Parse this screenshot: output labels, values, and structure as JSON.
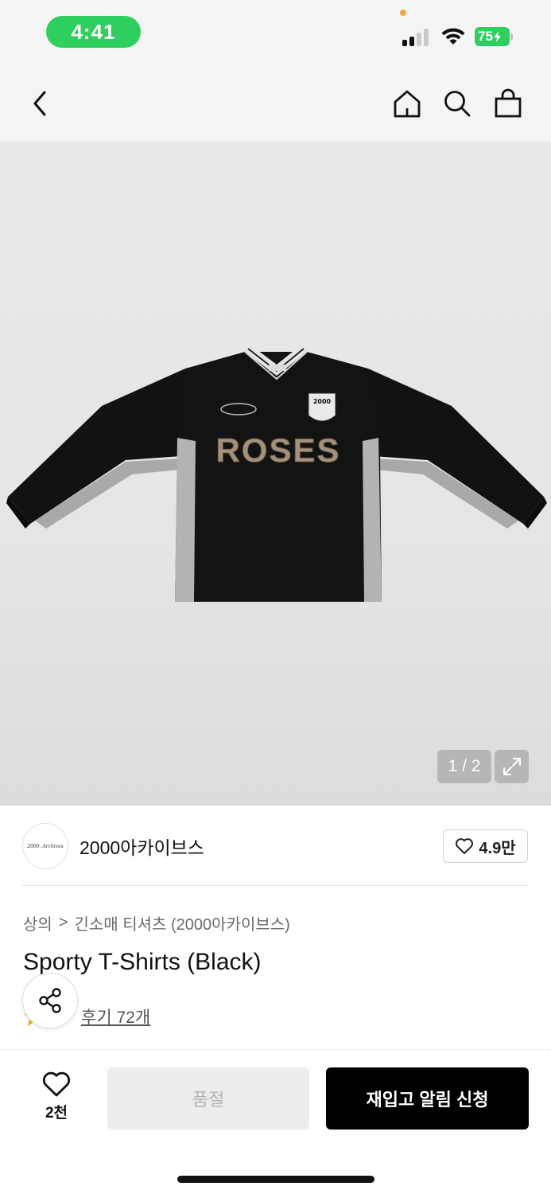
{
  "status_bar": {
    "time": "4:41",
    "battery": "75",
    "time_pill_color": "#2fcf5f",
    "battery_color": "#2fcf5f"
  },
  "nav": {
    "icons": [
      "chevron-left-icon",
      "home-icon",
      "search-icon",
      "shopping-bag-icon"
    ]
  },
  "gallery": {
    "counter": "1 / 2",
    "graphic_text": "ROSES",
    "crest_text": "2000"
  },
  "brand": {
    "logo_text": "2000. Archives",
    "name": "2000아카이브스",
    "likes": "4.9만"
  },
  "breadcrumb": {
    "parent": "상의",
    "separator": ">",
    "current": "긴소매 티셔츠 (2000아카이브스)"
  },
  "product": {
    "title": "Sporty T-Shirts (Black)",
    "review_link": "후기 72개"
  },
  "bottom_bar": {
    "wish_count": "2천",
    "soldout_label": "품절",
    "restock_label": "재입고 알림 신청"
  }
}
